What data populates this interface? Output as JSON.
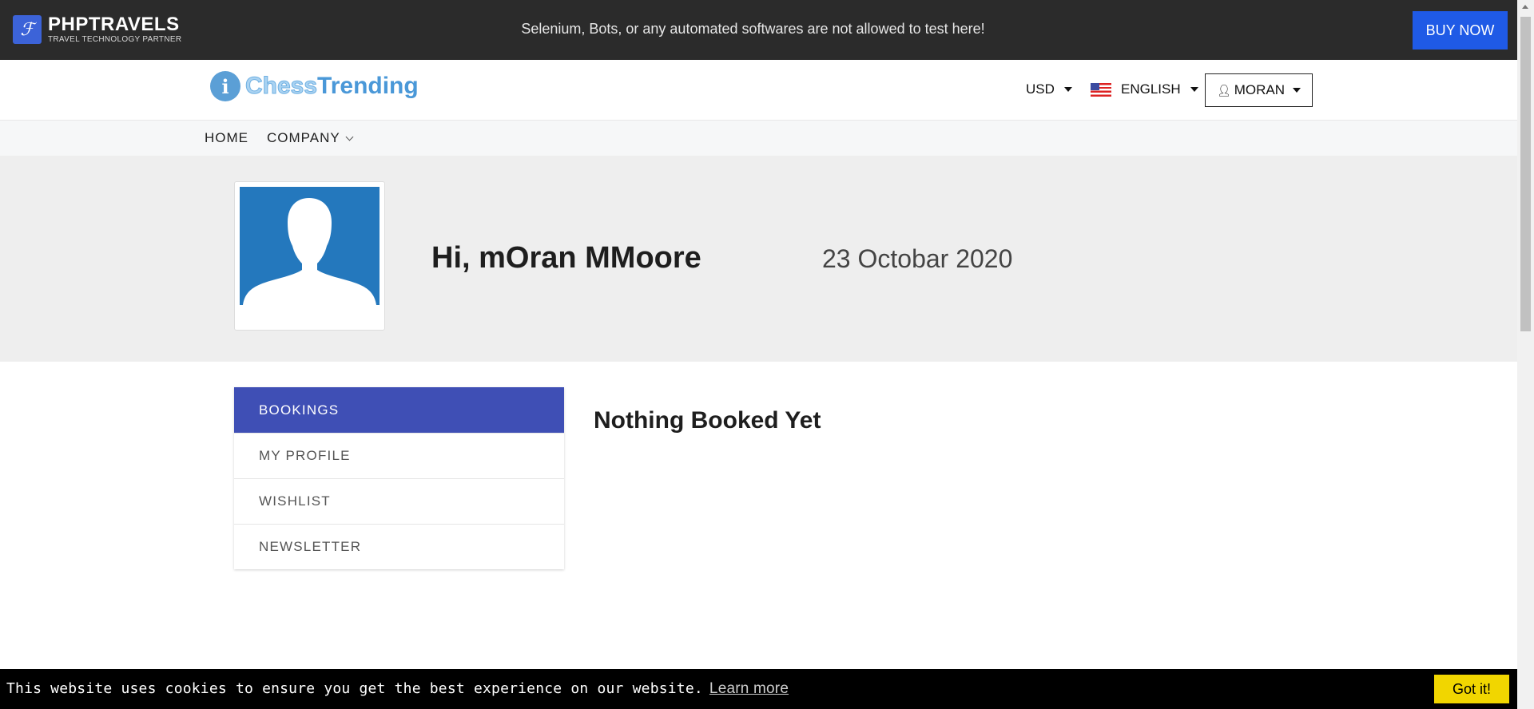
{
  "topbar": {
    "brand_mark": "ℱ",
    "brand_name": "PHPTRAVELS",
    "brand_tagline": "TRAVEL TECHNOLOGY PARTNER",
    "notice": "Selenium, Bots, or any automated softwares are not allowed to test here!",
    "buy_now": "BUY NOW",
    "bg_color": "#2b2b2b",
    "button_color": "#1f5ae6"
  },
  "header": {
    "logo_icon": "i",
    "logo_chess": "Chess",
    "logo_trending": "Trending",
    "currency": "USD",
    "language": "ENGLISH",
    "user": "MORAN"
  },
  "nav": {
    "items": [
      {
        "label": "HOME"
      },
      {
        "label": "COMPANY"
      }
    ]
  },
  "profile": {
    "greeting": "Hi, mOran MMoore",
    "date": "23 Octobar 2020"
  },
  "menu": {
    "active_color": "#3f4fb5",
    "items": [
      {
        "label": "BOOKINGS",
        "active": true
      },
      {
        "label": "MY PROFILE",
        "active": false
      },
      {
        "label": "WISHLIST",
        "active": false
      },
      {
        "label": "NEWSLETTER",
        "active": false
      }
    ]
  },
  "content": {
    "title": "Nothing Booked Yet"
  },
  "cookie": {
    "message": "This website uses cookies to ensure you get the best experience on our website.",
    "learn_more": "Learn more",
    "accept": "Got it!",
    "accept_color": "#f1d600"
  }
}
